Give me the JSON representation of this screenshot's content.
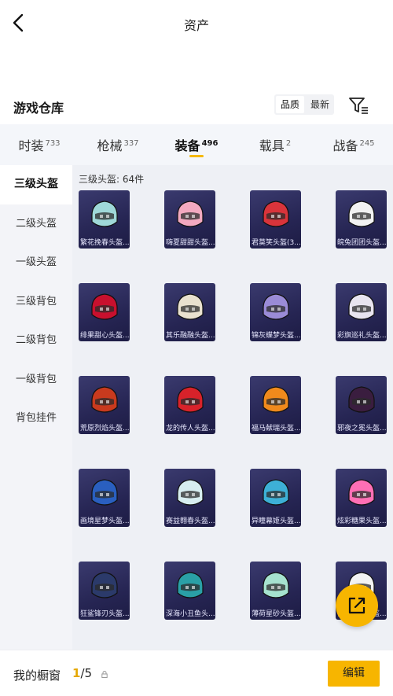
{
  "header": {
    "title": "资产"
  },
  "section": {
    "title": "游戏仓库",
    "sort": {
      "quality": "品质",
      "latest": "最新"
    }
  },
  "tabs": [
    {
      "label": "时装",
      "count": "733",
      "active": false
    },
    {
      "label": "枪械",
      "count": "337",
      "active": false
    },
    {
      "label": "装备",
      "count": "496",
      "active": true
    },
    {
      "label": "载具",
      "count": "2",
      "active": false
    },
    {
      "label": "战备",
      "count": "245",
      "active": false
    }
  ],
  "sidebar": {
    "items": [
      {
        "label": "三级头盔",
        "active": true
      },
      {
        "label": "二级头盔"
      },
      {
        "label": "一级头盔"
      },
      {
        "label": "三级背包"
      },
      {
        "label": "二级背包"
      },
      {
        "label": "一级背包"
      },
      {
        "label": "背包挂件"
      }
    ]
  },
  "content": {
    "count_label": "三级头盔: 64件",
    "items": [
      {
        "name": "繁花挽春头盔...",
        "color": "#9fd8d8"
      },
      {
        "name": "嗨夏甜甜头盔...",
        "color": "#f3a9c0"
      },
      {
        "name": "君莫笑头盔(3...",
        "color": "#d9343b"
      },
      {
        "name": "皖兔团团头盔...",
        "color": "#f2f2f2"
      },
      {
        "name": "绯果甜心头盔...",
        "color": "#c8102e"
      },
      {
        "name": "其乐融融头盔...",
        "color": "#e9e1cf"
      },
      {
        "name": "锦灰蝶梦头盔...",
        "color": "#9a8bd6"
      },
      {
        "name": "彩旗巡礼头盔...",
        "color": "#e8e4ef"
      },
      {
        "name": "荒原烈焰头盔...",
        "color": "#c83a1e"
      },
      {
        "name": "龙的传人头盔...",
        "color": "#d8222a"
      },
      {
        "name": "福马献瑞头盔...",
        "color": "#f08a1c"
      },
      {
        "name": "邪夜之冕头盔...",
        "color": "#3a1d3f"
      },
      {
        "name": "画境星梦头盔...",
        "color": "#2a5fbf"
      },
      {
        "name": "赛益翱春头盔...",
        "color": "#d7eef0"
      },
      {
        "name": "异瞳幕姬头盔...",
        "color": "#3db0d6"
      },
      {
        "name": "炫彩糖果头盔...",
        "color": "#ff6fb5"
      },
      {
        "name": "狂鲨锋刃头盔...",
        "color": "#2b3a6a"
      },
      {
        "name": "深海小丑鱼头...",
        "color": "#2aa0a6"
      },
      {
        "name": "薄荷星砂头盔...",
        "color": "#a6e3cf"
      },
      {
        "name": "白羽挚翼头盔...",
        "color": "#f3f3f3"
      }
    ]
  },
  "bottom": {
    "label": "我的橱窗",
    "current": "1",
    "total": "/5",
    "edit": "编辑"
  },
  "colors": {
    "accent": "#f7b500"
  }
}
